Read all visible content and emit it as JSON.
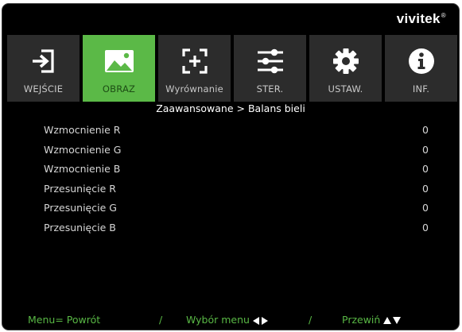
{
  "brand": {
    "name": "vivitek",
    "trademark": "®"
  },
  "tabs": [
    {
      "label": "WEJŚCIE",
      "icon": "input-arrow-icon",
      "active": false
    },
    {
      "label": "OBRAZ",
      "icon": "picture-icon",
      "active": true
    },
    {
      "label": "Wyrównanie",
      "icon": "alignment-crosshair-icon",
      "active": false
    },
    {
      "label": "STER.",
      "icon": "sliders-icon",
      "active": false
    },
    {
      "label": "USTAW.",
      "icon": "gear-icon",
      "active": false
    },
    {
      "label": "INF.",
      "icon": "info-icon",
      "active": false
    }
  ],
  "breadcrumb": "Zaawansowane > Balans bieli",
  "rows": [
    {
      "label": "Wzmocnienie R",
      "value": "0"
    },
    {
      "label": "Wzmocnienie G",
      "value": "0"
    },
    {
      "label": "Wzmocnienie B",
      "value": "0"
    },
    {
      "label": "Przesunięcie R",
      "value": "0"
    },
    {
      "label": "Przesunięcie G",
      "value": "0"
    },
    {
      "label": "Przesunięcie B",
      "value": "0"
    }
  ],
  "footer": {
    "back": "Menu= Powrót",
    "sep1": "/",
    "select": "Wybór menu",
    "sep2": "/",
    "scroll": "Przewiń"
  },
  "colors": {
    "accent": "#5bb947",
    "tab_bg": "#2c2c2c",
    "background": "#000000",
    "footer_text": "#59b845"
  }
}
